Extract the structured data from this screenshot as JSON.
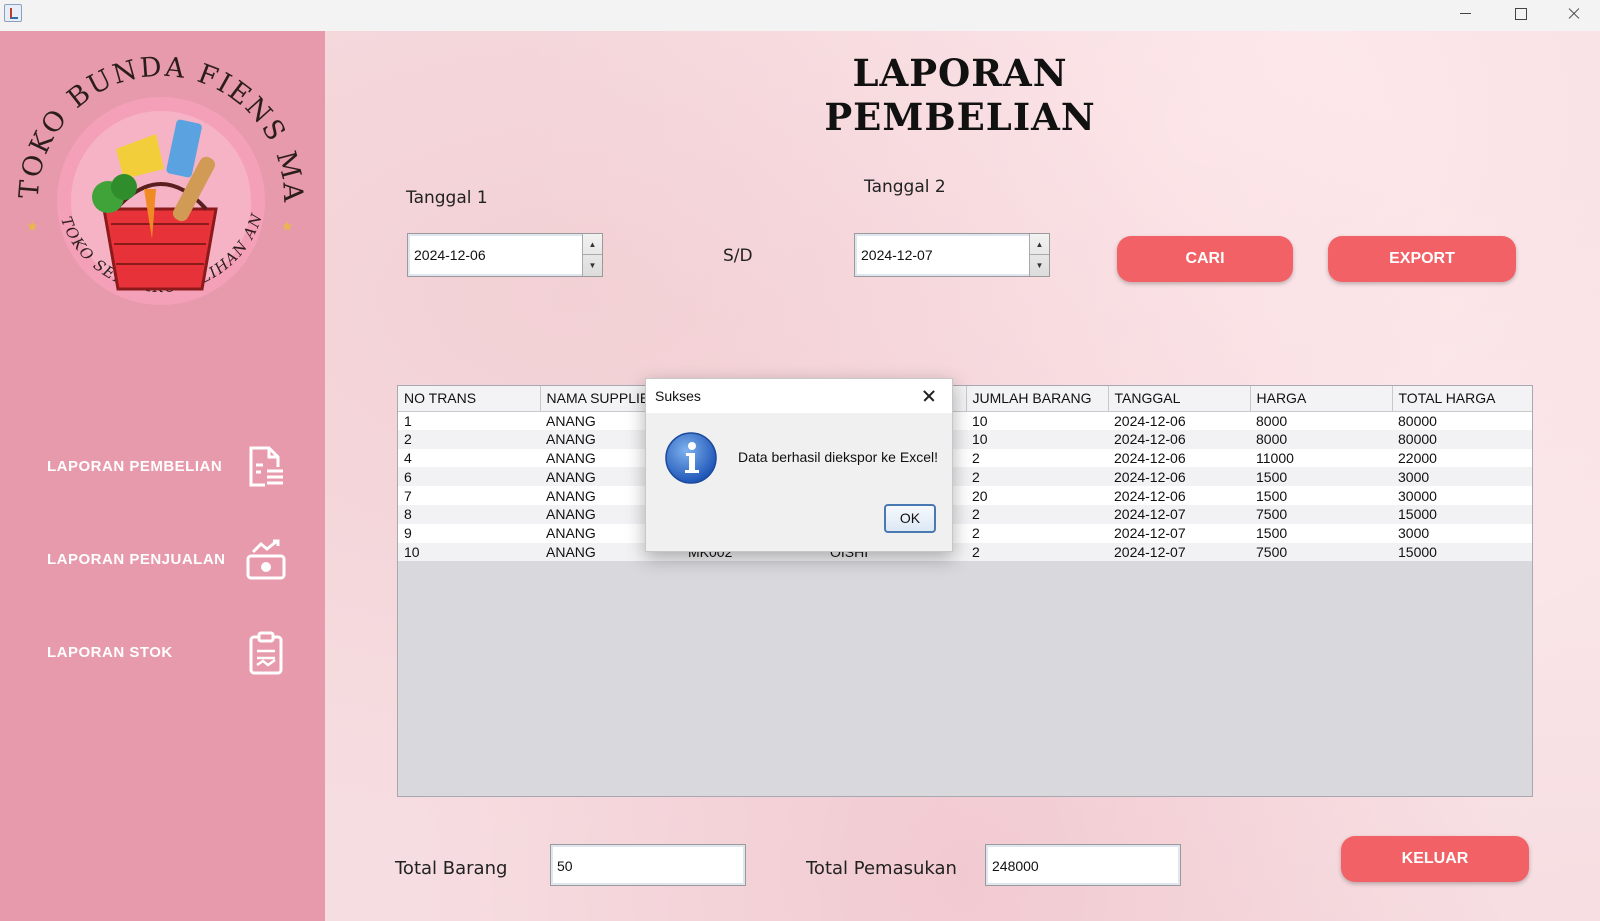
{
  "window": {
    "icon": "java-cup-icon"
  },
  "sidebar": {
    "logo": {
      "text_top": "TOKO BUNDA FIENS MART",
      "text_bottom": "TOKO SEMBAKO PILIHAN ANDA"
    },
    "items": [
      {
        "label": "LAPORAN PEMBELIAN",
        "icon": "document-icon"
      },
      {
        "label": "LAPORAN PENJUALAN",
        "icon": "money-icon"
      },
      {
        "label": "LAPORAN STOK",
        "icon": "clipboard-icon"
      }
    ]
  },
  "header": {
    "title": "LAPORAN PEMBELIAN"
  },
  "filter": {
    "date1_label": "Tanggal 1",
    "date1_value": "2024-12-06",
    "separator": "S/D",
    "date2_label": "Tanggal 2",
    "date2_value": "2024-12-07",
    "search_label": "CARI",
    "export_label": "EXPORT"
  },
  "table": {
    "columns": [
      "NO TRANS",
      "NAMA SUPPLIER",
      "",
      "",
      "JUMLAH BARANG",
      "TANGGAL",
      "HARGA",
      "TOTAL HARGA"
    ],
    "rows": [
      [
        "1",
        "ANANG",
        "",
        "",
        "10",
        "2024-12-06",
        "8000",
        "80000"
      ],
      [
        "2",
        "ANANG",
        "",
        "",
        "10",
        "2024-12-06",
        "8000",
        "80000"
      ],
      [
        "4",
        "ANANG",
        "",
        "",
        "2",
        "2024-12-06",
        "11000",
        "22000"
      ],
      [
        "6",
        "ANANG",
        "",
        "",
        "2",
        "2024-12-06",
        "1500",
        "3000"
      ],
      [
        "7",
        "ANANG",
        "",
        "",
        "20",
        "2024-12-06",
        "1500",
        "30000"
      ],
      [
        "8",
        "ANANG",
        "",
        "",
        "2",
        "2024-12-07",
        "7500",
        "15000"
      ],
      [
        "9",
        "ANANG",
        "",
        "",
        "2",
        "2024-12-07",
        "1500",
        "3000"
      ],
      [
        "10",
        "ANANG",
        "MK002",
        "OISHI",
        "2",
        "2024-12-07",
        "7500",
        "15000"
      ]
    ]
  },
  "footer": {
    "total_barang_label": "Total Barang",
    "total_barang_value": "50",
    "total_pemasukan_label": "Total Pemasukan",
    "total_pemasukan_value": "248000",
    "exit_label": "KELUAR"
  },
  "dialog": {
    "title": "Sukses",
    "message": "Data berhasil diekspor ke Excel!",
    "ok_label": "OK",
    "icon": "info-icon"
  },
  "colors": {
    "sidebar": "#e79aab",
    "button": "#f26166",
    "background": "#f6dde1"
  }
}
